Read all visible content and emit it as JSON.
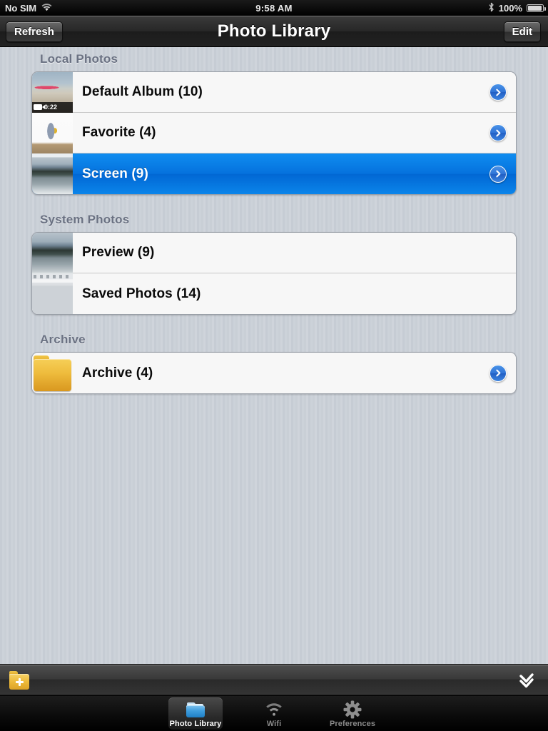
{
  "status_bar": {
    "carrier": "No SIM",
    "wifi_icon": "wifi-icon",
    "time": "9:58 AM",
    "bluetooth_icon": "bluetooth-icon",
    "battery_percent": "100%",
    "battery_icon": "battery-full-icon"
  },
  "nav_bar": {
    "left_button": "Refresh",
    "title": "Photo Library",
    "right_button": "Edit"
  },
  "sections": [
    {
      "header": "Local Photos",
      "rows": [
        {
          "label": "Default Album (10)",
          "thumb": "plane",
          "selected": false,
          "chevron": true,
          "video_badge": {
            "duration": "0:22",
            "icon": "video-camera-icon"
          }
        },
        {
          "label": "Favorite (4)",
          "thumb": "person",
          "selected": false,
          "chevron": true,
          "video_badge": null
        },
        {
          "label": "Screen (9)",
          "thumb": "lake",
          "selected": true,
          "chevron": true,
          "video_badge": null
        }
      ]
    },
    {
      "header": "System Photos",
      "rows": [
        {
          "label": "Preview (9)",
          "thumb": "lake-system",
          "selected": false,
          "chevron": false,
          "video_badge": null
        },
        {
          "label": "Saved Photos (14)",
          "thumb": "document",
          "selected": false,
          "chevron": false,
          "video_badge": null
        }
      ]
    },
    {
      "header": "Archive",
      "rows": [
        {
          "label": "Archive (4)",
          "thumb": "folder",
          "selected": false,
          "chevron": true,
          "video_badge": null
        }
      ]
    }
  ],
  "toolbar": {
    "add_folder_icon": "add-folder-icon",
    "select_all_icon": "double-check-icon"
  },
  "tab_bar": {
    "items": [
      {
        "label": "Photo Library",
        "icon": "folder-icon",
        "active": true
      },
      {
        "label": "Wifi",
        "icon": "wifi-icon",
        "active": false
      },
      {
        "label": "Preferences",
        "icon": "gear-icon",
        "active": false
      }
    ]
  },
  "colors": {
    "selection_blue": "#0571dd",
    "chevron_blue": "#2f72d6",
    "folder_gold": "#eebb3c",
    "section_header_text": "#6a7182"
  }
}
